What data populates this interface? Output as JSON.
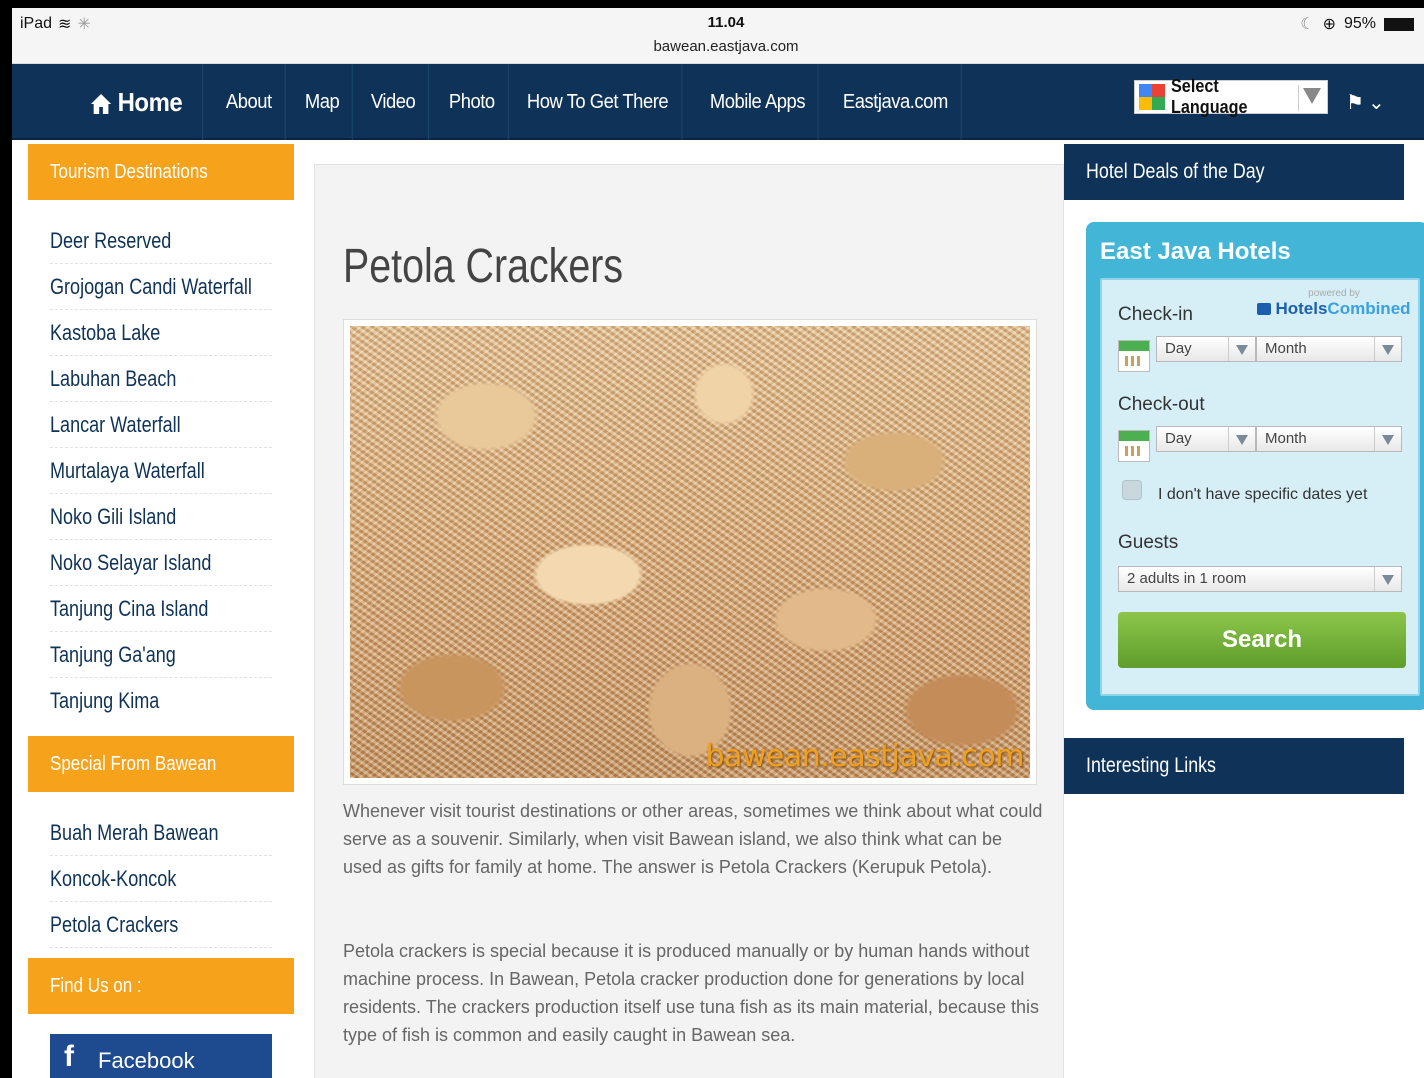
{
  "status": {
    "device": "iPad",
    "time": "11.04",
    "url": "bawean.eastjava.com",
    "battery": "95%"
  },
  "nav": {
    "home": "Home",
    "items": [
      "About",
      "Map",
      "Video",
      "Photo",
      "How To Get There",
      "Mobile Apps",
      "Eastjava.com"
    ],
    "language": "Select Language"
  },
  "sidebar": {
    "tourism_header": "Tourism Destinations",
    "tourism_items": [
      "Deer Reserved",
      "Grojogan Candi Waterfall",
      "Kastoba Lake",
      "Labuhan Beach",
      "Lancar Waterfall",
      "Murtalaya Waterfall",
      "Noko Gili Island",
      "Noko Selayar Island",
      "Tanjung Cina Island",
      "Tanjung Ga'ang",
      "Tanjung Kima"
    ],
    "special_header": "Special From Bawean",
    "special_items": [
      "Buah Merah Bawean",
      "Koncok-Koncok",
      "Petola Crackers"
    ],
    "find_header": "Find Us on :",
    "facebook_label": "Facebook"
  },
  "main": {
    "title": "Petola Crackers",
    "watermark": "bawean.eastjava.com",
    "paragraph1": "Whenever visit tourist destinations or other areas, sometimes we think about what could serve as a souvenir. Similarly, when visit Bawean island, we also think what can be used as gifts for family at home. The answer is Petola Crackers (Kerupuk Petola).",
    "paragraph2": "Petola crackers is special because it is produced manually or by human hands without machine process. In Bawean, Petola cracker production done for generations by local residents. The crackers production itself use tuna fish as its main material, because this type of fish is common and easily caught in Bawean sea."
  },
  "right": {
    "deals_header": "Hotel Deals of the Day",
    "widget_title": "East Java Hotels",
    "powered_by": "powered by",
    "brand_a": "Hotels",
    "brand_b": "Combined",
    "checkin_label": "Check-in",
    "checkout_label": "Check-out",
    "day_select": "Day",
    "month_select": "Month",
    "no_dates_label": "I don't have specific dates yet",
    "guests_label": "Guests",
    "guests_select": "2 adults in 1 room",
    "search_label": "Search",
    "links_header": "Interesting Links"
  },
  "colors": {
    "nav_bg": "#0f3358",
    "orange_header": "#f7a21b",
    "widget_bg": "#43b6d8",
    "search_green": "#6aab34"
  }
}
